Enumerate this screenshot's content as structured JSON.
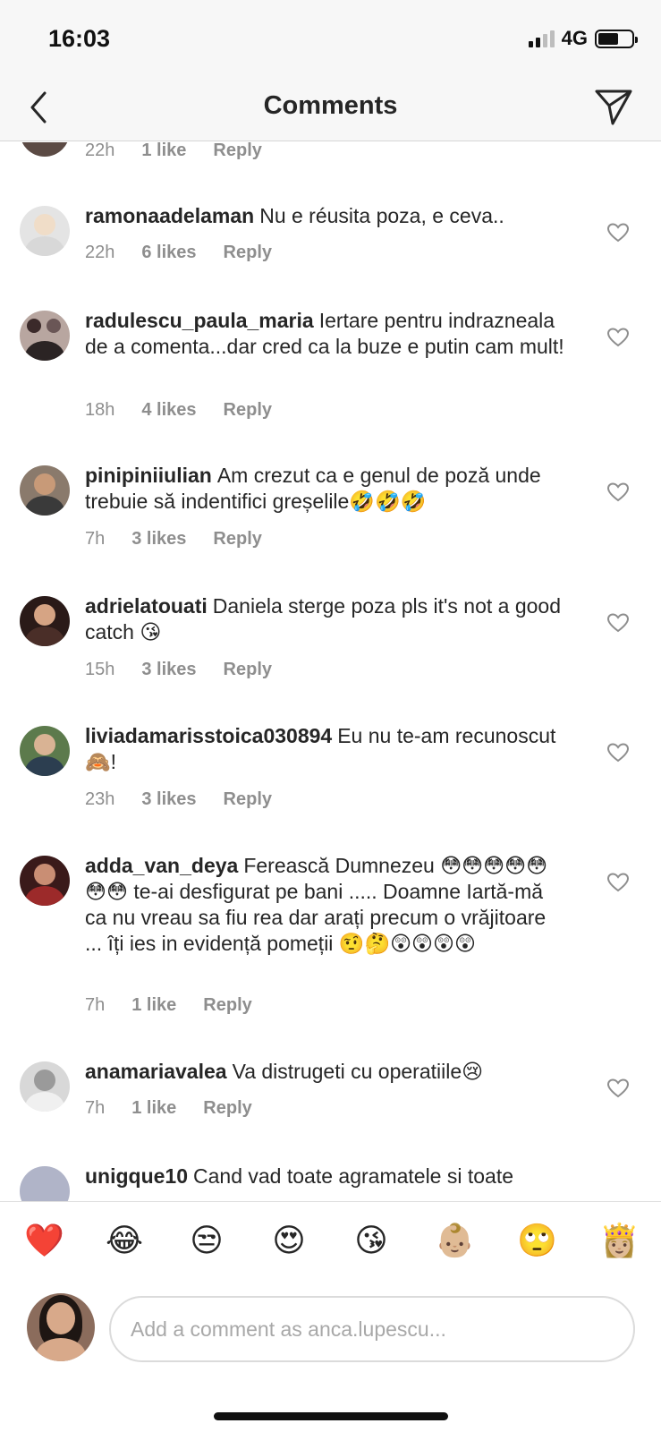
{
  "status": {
    "time": "16:03",
    "network": "4G"
  },
  "nav": {
    "title": "Comments"
  },
  "comments": [
    {
      "user": "",
      "text": "",
      "time": "22h",
      "likes": "1 like",
      "reply": "Reply"
    },
    {
      "user": "ramonaadelaman",
      "text": "Nu e réusita poza, e ceva..",
      "time": "22h",
      "likes": "6 likes",
      "reply": "Reply"
    },
    {
      "user": "radulescu_paula_maria",
      "text": "Iertare pentru indrazneala de a comenta...dar cred ca la buze e putin cam mult!",
      "time": "18h",
      "likes": "4 likes",
      "reply": "Reply"
    },
    {
      "user": "pinipiniiulian",
      "text": "Am crezut ca e genul de poză unde trebuie să indentifici greșelile🤣🤣🤣",
      "time": "7h",
      "likes": "3 likes",
      "reply": "Reply"
    },
    {
      "user": "adrielatouati",
      "text": "Daniela sterge poza pls it's not a good catch 😘",
      "time": "15h",
      "likes": "3 likes",
      "reply": "Reply"
    },
    {
      "user": "liviadamarisstoica030894",
      "text": "Eu nu te-am recunoscut 🙈!",
      "time": "23h",
      "likes": "3 likes",
      "reply": "Reply"
    },
    {
      "user": "adda_van_deya",
      "text": "Ferească Dumnezeu 😳😳😳😳😳😳😳 te-ai desfigurat pe bani ..... Doamne Iartă-mă ca nu vreau sa fiu rea dar arați precum o vrăjitoare ... îți ies in evidență pomeții 🤨🤔😲😲😲😲",
      "time": "7h",
      "likes": "1 like",
      "reply": "Reply"
    },
    {
      "user": "anamariavalea",
      "text": "Va distrugeti cu operatiile😢",
      "time": "7h",
      "likes": "1 like",
      "reply": "Reply"
    },
    {
      "user": "unigque10",
      "text": "Cand vad toate agramatele si toate",
      "time": "",
      "likes": "",
      "reply": ""
    }
  ],
  "emoji_bar": [
    "❤️",
    "😂",
    "😒",
    "😍",
    "😘",
    "👶🏼",
    "🙄",
    "👸🏼"
  ],
  "composer": {
    "placeholder": "Add a comment as anca.lupescu..."
  },
  "colors": {
    "text": "#262626",
    "meta": "#8e8e8e",
    "border": "#dbdbdb",
    "bar": "#f7f7f7"
  }
}
